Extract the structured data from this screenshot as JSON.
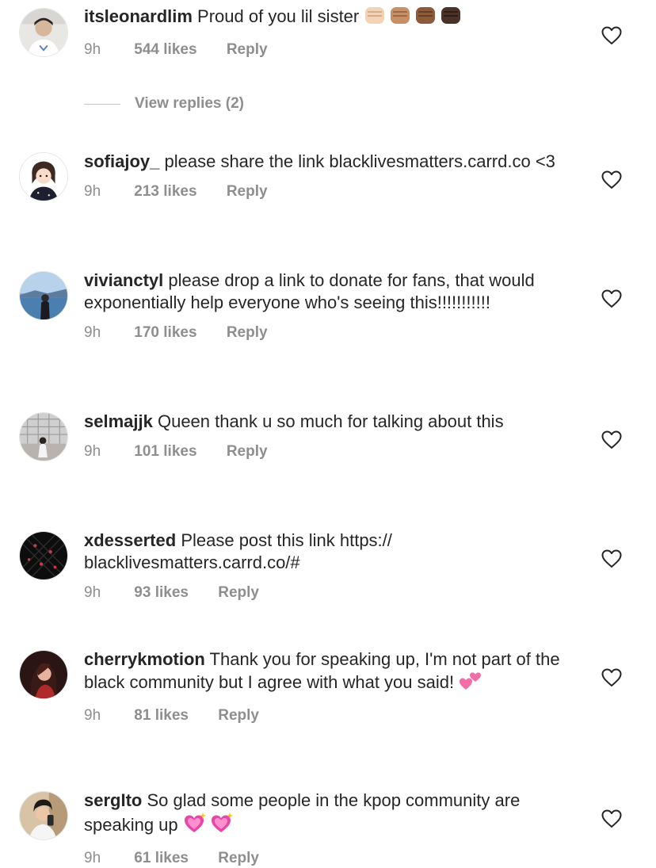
{
  "comments": [
    {
      "username": "itsleonardlim",
      "text": "Proud of you lil sister",
      "time": "9h",
      "likes": "544 likes",
      "reply": "Reply",
      "emoji": "raised-fist-skin-tones"
    },
    {
      "username": "sofiajoy_",
      "text": "please share the link blacklivesmatters.carrd.co <3",
      "time": "9h",
      "likes": "213 likes",
      "reply": "Reply"
    },
    {
      "username": "vivianctyl",
      "text": "please drop a link to donate for fans, that would exponentially help everyone who's seeing this!!!!!!!!!!!",
      "time": "9h",
      "likes": "170 likes",
      "reply": "Reply"
    },
    {
      "username": "selmajjk",
      "text": "Queen thank u so much for talking about this",
      "time": "9h",
      "likes": "101 likes",
      "reply": "Reply"
    },
    {
      "username": "xdesserted",
      "text": "Please post this link https:// blacklivesmatters.carrd.co/#",
      "time": "9h",
      "likes": "93 likes",
      "reply": "Reply"
    },
    {
      "username": "cherrykmotion",
      "text": "Thank you for speaking up, I'm not part of the black community but I agree with what you said!",
      "time": "9h",
      "likes": "81 likes",
      "reply": "Reply",
      "emoji": "two-hearts"
    },
    {
      "username": "sergIto",
      "text": "So glad some people in the kpop community are speaking up",
      "time": "9h",
      "likes": "61 likes",
      "reply": "Reply",
      "emoji": "sparkling-heart-x2"
    }
  ],
  "view_replies": "View replies (2)",
  "colors": {
    "text": "#262626",
    "meta": "#8e8e8e",
    "heart_outline": "#262626"
  },
  "icons": {
    "like": "heart-outline-icon"
  }
}
